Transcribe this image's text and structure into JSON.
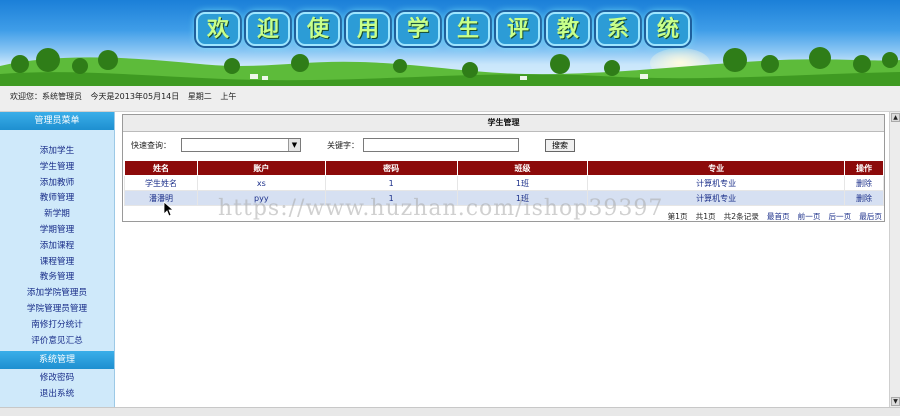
{
  "banner": {
    "chars": [
      "欢",
      "迎",
      "使",
      "用",
      "学",
      "生",
      "评",
      "教",
      "系",
      "统"
    ]
  },
  "info": {
    "welcome": "欢迎您：系统管理员",
    "date": "今天是2013年05月14日",
    "weekday": "星期二",
    "period": "上午"
  },
  "sidebar": {
    "header": "管理员菜单",
    "items": [
      "添加学生",
      "学生管理",
      "添加教师",
      "教师管理",
      "新学期",
      "学期管理",
      "添加课程",
      "课程管理",
      "教务管理",
      "添加学院管理员",
      "学院管理员管理",
      "南修打分统计",
      "评价意见汇总"
    ],
    "section": "系统管理",
    "section_items": [
      "修改密码",
      "退出系统"
    ]
  },
  "panel": {
    "title": "学生管理",
    "quick_label": "快速查询：",
    "quick_value": "",
    "keyword_label": "关键字：",
    "keyword_value": "",
    "search_button": "搜索"
  },
  "table": {
    "headers": [
      "姓名",
      "账户",
      "密码",
      "班级",
      "专业",
      "操作"
    ],
    "rows": [
      [
        "学生姓名",
        "xs",
        "1",
        "1班",
        "计算机专业",
        "删除"
      ],
      [
        "潘潘明",
        "pyy",
        "1",
        "1班",
        "计算机专业",
        "删除"
      ]
    ]
  },
  "pager": {
    "page": "第1页",
    "total_pages": "共1页",
    "total_records": "共2条记录",
    "first": "最首页",
    "prev": "前一页",
    "next": "后一页",
    "last": "最后页"
  },
  "watermark": "https://www.huzhan.com/ishop39397",
  "colors": {
    "header_red": "#8c0a0a",
    "sidebar_blue": "#1e8fd0",
    "link_blue": "#1b2f8a"
  }
}
